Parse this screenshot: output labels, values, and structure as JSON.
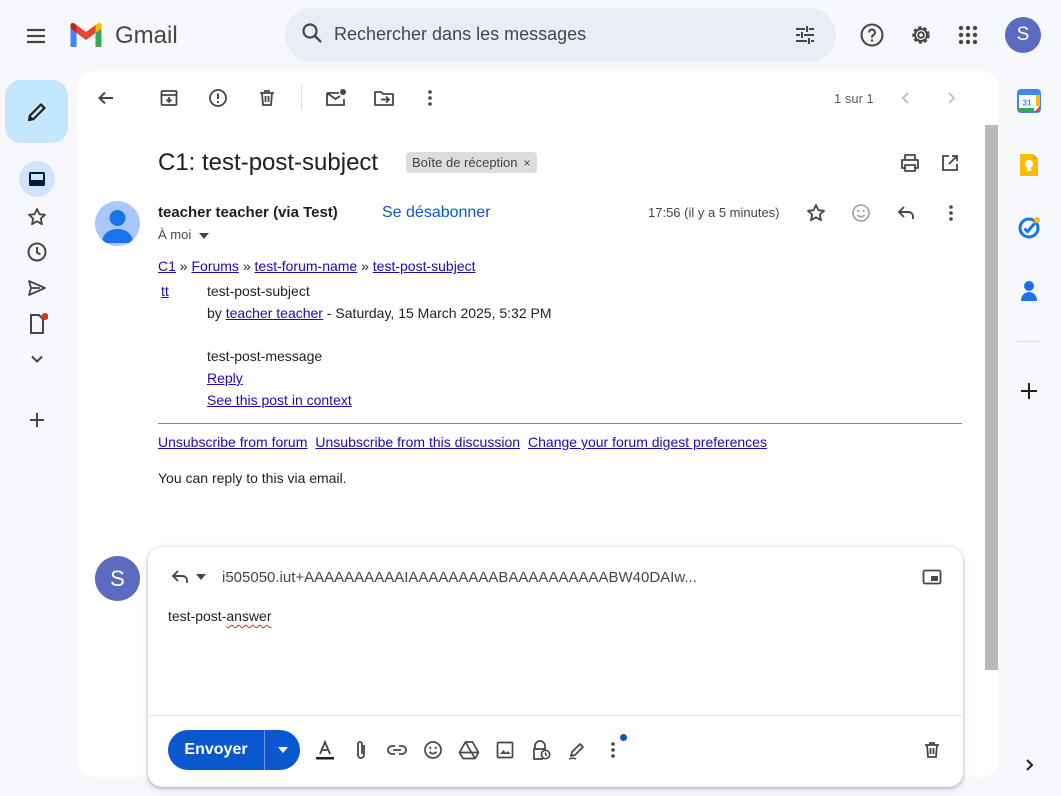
{
  "app": {
    "name": "Gmail"
  },
  "search": {
    "placeholder": "Rechercher dans les messages"
  },
  "account": {
    "initial": "S"
  },
  "colors": {
    "accent": "#0b57d0",
    "compose_bg": "#c2e7ff",
    "avatar": "#5c6bc0",
    "link": "#1a0dab"
  },
  "toolbar": {
    "pager": "1 sur 1"
  },
  "message": {
    "subject": "C1: test-post-subject",
    "label": "Boîte de réception",
    "sender": "teacher teacher (via Test)",
    "unsubscribe": "Se désabonner",
    "to": "À moi",
    "time": "17:56 (il y a 5 minutes)"
  },
  "body": {
    "breadcrumb": [
      {
        "text": "C1",
        "link": true
      },
      {
        "text": " » ",
        "link": false
      },
      {
        "text": "Forums",
        "link": true
      },
      {
        "text": " » ",
        "link": false
      },
      {
        "text": "test-forum-name",
        "link": true
      },
      {
        "text": " » ",
        "link": false
      },
      {
        "text": "test-post-subject",
        "link": true
      }
    ],
    "user_link": "tt",
    "post_subject": "test-post-subject",
    "by_prefix": "by ",
    "author": "teacher teacher",
    "date": " - Saturday, 15 March 2025, 5:32 PM",
    "post_message": "test-post-message",
    "reply_link": "Reply",
    "context_link": "See this post in context",
    "footer_links": [
      "Unsubscribe from forum",
      "Unsubscribe from this discussion",
      "Change your forum digest preferences"
    ],
    "reply_note": "You can reply to this via email."
  },
  "composer": {
    "to": "i505050.iut+AAAAAAAAAAIAAAAAAAAABAAAAAAAAAABW40DAIw...",
    "text_before": "test-post-",
    "text_misspelled": "answer",
    "send_label": "Envoyer"
  },
  "side_panel": {
    "calendar_day": "31",
    "apps": [
      "calendar-icon",
      "keep-icon",
      "tasks-icon",
      "contacts-icon"
    ]
  }
}
